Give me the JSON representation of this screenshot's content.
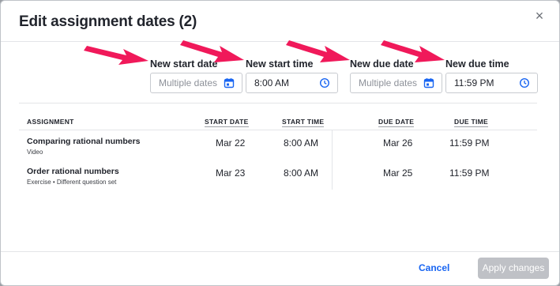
{
  "modal": {
    "title": "Edit assignment dates (2)",
    "close_symbol": "×"
  },
  "fields": {
    "start_date": {
      "label": "New start date",
      "placeholder": "Multiple dates",
      "icon": "calendar-icon"
    },
    "start_time": {
      "label": "New start time",
      "value": "8:00 AM",
      "icon": "clock-icon"
    },
    "due_date": {
      "label": "New due date",
      "placeholder": "Multiple dates",
      "icon": "calendar-icon"
    },
    "due_time": {
      "label": "New due time",
      "value": "11:59 PM",
      "icon": "clock-icon"
    }
  },
  "table": {
    "headers": [
      "ASSIGNMENT",
      "START DATE",
      "START TIME",
      "DUE DATE",
      "DUE TIME"
    ],
    "rows": [
      {
        "title": "Comparing rational numbers",
        "subtitle": "Video",
        "start_date": "Mar 22",
        "start_time": "8:00 AM",
        "due_date": "Mar 26",
        "due_time": "11:59 PM"
      },
      {
        "title": "Order rational numbers",
        "subtitle": "Exercise • Different question set",
        "start_date": "Mar 23",
        "start_time": "8:00 AM",
        "due_date": "Mar 25",
        "due_time": "11:59 PM"
      }
    ]
  },
  "footer": {
    "cancel_label": "Cancel",
    "apply_label": "Apply changes"
  },
  "colors": {
    "accent": "#1865f2",
    "annotation_arrow": "#f0195a",
    "disabled_button": "#bfc1c6"
  }
}
